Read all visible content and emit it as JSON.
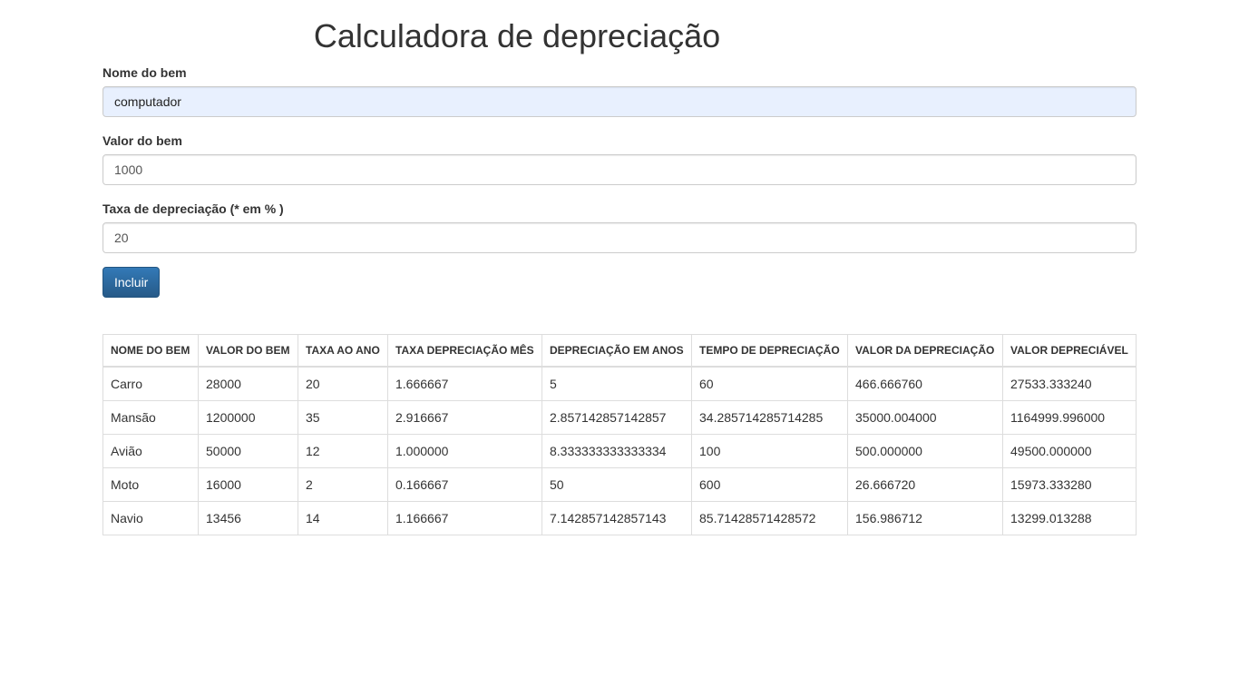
{
  "page": {
    "title": "Calculadora de depreciação"
  },
  "form": {
    "nome": {
      "label": "Nome do bem",
      "value": "computador"
    },
    "valor": {
      "label": "Valor do bem",
      "value": "1000"
    },
    "taxa": {
      "label": "Taxa de depreciação (* em % )",
      "value": "20"
    },
    "submit_label": "Incluir"
  },
  "table": {
    "headers": [
      "NOME DO BEM",
      "VALOR DO BEM",
      "TAXA AO ANO",
      "TAXA DEPRECIAÇÃO MÊS",
      "DEPRECIAÇÃO EM ANOS",
      "TEMPO DE DEPRECIAÇÃO",
      "VALOR DA DEPRECIAÇÃO",
      "VALOR DEPRECIÁVEL"
    ],
    "rows": [
      [
        "Carro",
        "28000",
        "20",
        "1.666667",
        "5",
        "60",
        "466.666760",
        "27533.333240"
      ],
      [
        "Mansão",
        "1200000",
        "35",
        "2.916667",
        "2.857142857142857",
        "34.285714285714285",
        "35000.004000",
        "1164999.996000"
      ],
      [
        "Avião",
        "50000",
        "12",
        "1.000000",
        "8.333333333333334",
        "100",
        "500.000000",
        "49500.000000"
      ],
      [
        "Moto",
        "16000",
        "2",
        "0.166667",
        "50",
        "600",
        "26.666720",
        "15973.333280"
      ],
      [
        "Navio",
        "13456",
        "14",
        "1.166667",
        "7.142857142857143",
        "85.71428571428572",
        "156.986712",
        "13299.013288"
      ]
    ]
  }
}
